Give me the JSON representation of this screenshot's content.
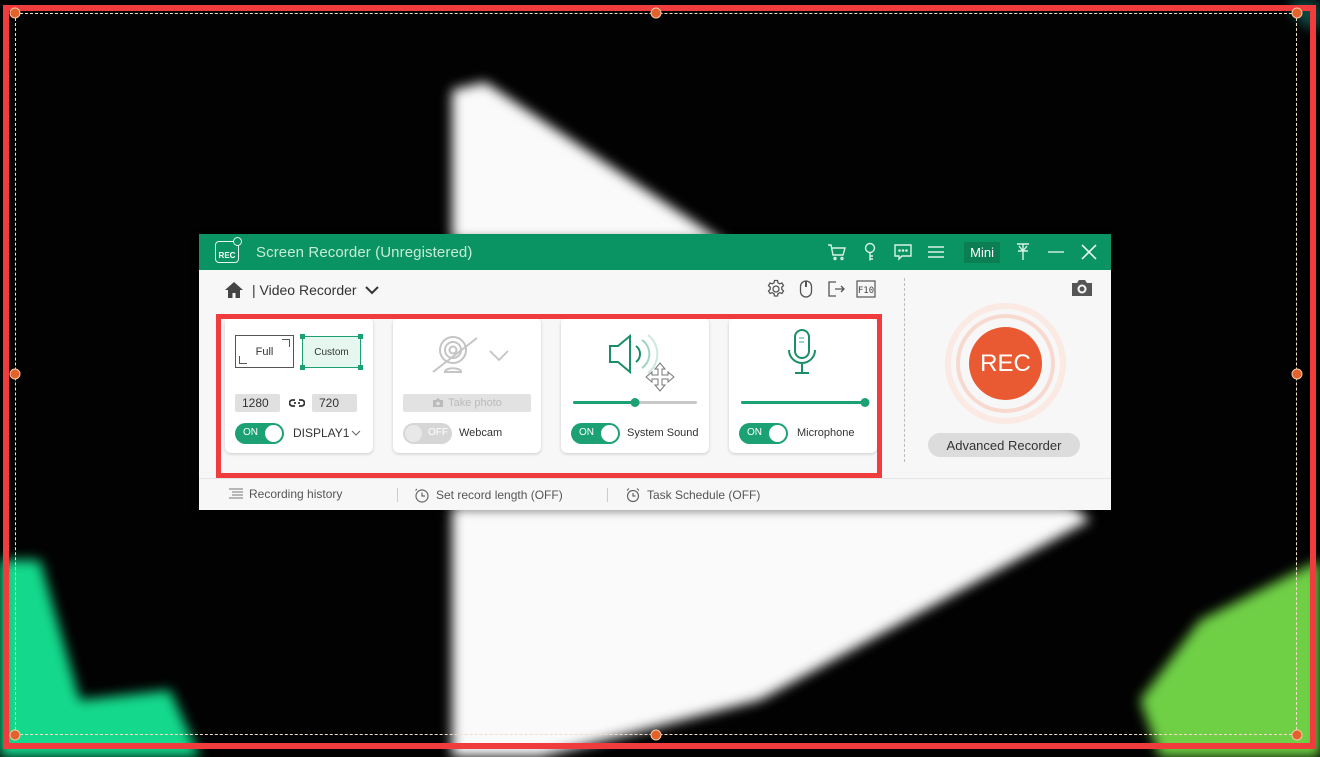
{
  "window": {
    "title": "Screen Recorder (Unregistered)",
    "logo_text": "REC",
    "mini_label": "Mini",
    "titlebar_icons": [
      "cart-icon",
      "key-icon",
      "chat-icon",
      "menu-icon"
    ],
    "window_controls": [
      "pin-icon",
      "minimize-icon",
      "close-icon"
    ]
  },
  "subbar": {
    "mode_label": "| Video Recorder",
    "tools": [
      "settings-icon",
      "mouse-icon",
      "export-icon",
      "f10-hotkey-icon"
    ],
    "f10_label": "F10"
  },
  "area_card": {
    "full_label": "Full",
    "custom_label": "Custom",
    "selected": "Custom",
    "width": "1280",
    "height": "720",
    "toggle_label": "ON",
    "display_label": "DISPLAY1"
  },
  "webcam_card": {
    "take_photo_label": "Take photo",
    "toggle_label": "OFF",
    "label": "Webcam"
  },
  "system_sound_card": {
    "volume_percent": 50,
    "toggle_label": "ON",
    "label": "System Sound"
  },
  "microphone_card": {
    "volume_percent": 100,
    "toggle_label": "ON",
    "label": "Microphone"
  },
  "rec_button_label": "REC",
  "advanced_recorder_label": "Advanced Recorder",
  "footer": {
    "recording_history": "Recording history",
    "record_length": "Set record length (OFF)",
    "task_schedule": "Task Schedule (OFF)"
  },
  "colors": {
    "brand_green": "#0a9363",
    "accent_green": "#1ca175",
    "rec_orange": "#ea5a32",
    "selection_red": "#f03c3c"
  }
}
